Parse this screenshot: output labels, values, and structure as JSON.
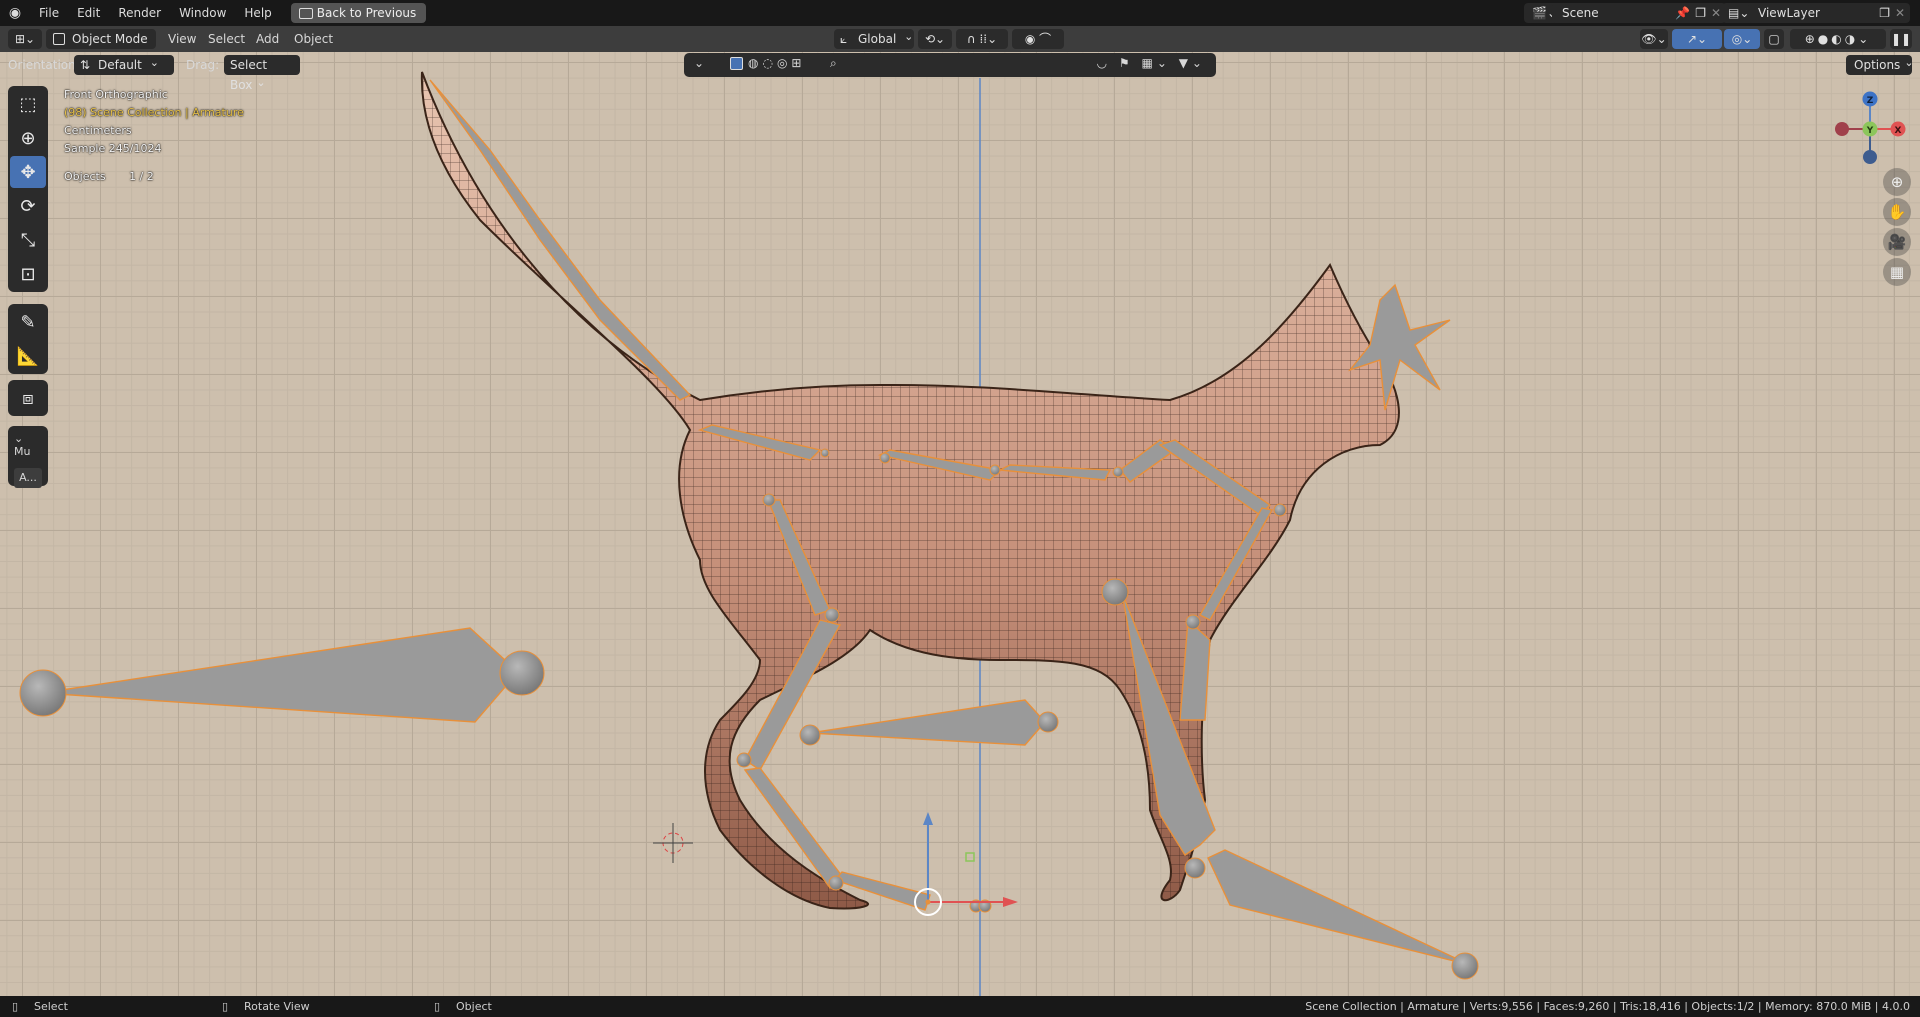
{
  "topbar": {
    "menus": [
      "File",
      "Edit",
      "Render",
      "Window",
      "Help"
    ],
    "back_button": "Back to Previous",
    "scene": "Scene",
    "view_layer": "ViewLayer"
  },
  "header": {
    "mode": "Object Mode",
    "menus": [
      "View",
      "Select",
      "Add",
      "Object"
    ],
    "transform_orientation": "Global",
    "options_label": "Options"
  },
  "tool_settings": {
    "orientation_label": "Orientation:",
    "orientation_value": "Default",
    "drag_label": "Drag:",
    "drag_value": "Select Box"
  },
  "viewport_overlay": {
    "view_name": "Front Orthographic",
    "collection": "(98) Scene Collection | Armature",
    "units": "Centimeters",
    "sample": "Sample 245/1024",
    "objects_label": "Objects",
    "objects_count": "1 / 2"
  },
  "left_panel": {
    "section_label": "Mu",
    "button_label": "A..."
  },
  "gizmo": {
    "z": "Z",
    "y": "Y",
    "x": "X"
  },
  "statusbar": {
    "left_select": "Select",
    "rotate_view": "Rotate View",
    "object": "Object",
    "stats": "Scene Collection | Armature | Verts:9,556 | Faces:9,260 | Tris:18,416 | Objects:1/2 | Memory: 870.0 MiB | 4.0.0"
  },
  "colors": {
    "accent": "#4772b3",
    "viewport_bg": "#cdbfad",
    "bone": "#9a9a9a",
    "selection": "#e8903a",
    "mesh": "#c99a86"
  }
}
